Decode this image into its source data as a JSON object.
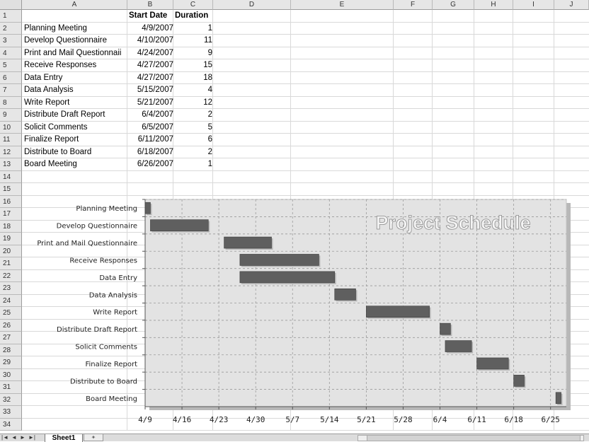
{
  "spreadsheet": {
    "columns": [
      "A",
      "B",
      "C",
      "D",
      "E",
      "F",
      "G",
      "H",
      "I",
      "J"
    ],
    "row_numbers": [
      "1",
      "2",
      "3",
      "4",
      "5",
      "6",
      "7",
      "8",
      "9",
      "10",
      "11",
      "12",
      "13",
      "14",
      "15",
      "16",
      "17",
      "18",
      "19",
      "20",
      "21",
      "22",
      "23",
      "24",
      "25",
      "26",
      "27",
      "28",
      "29",
      "30",
      "31",
      "32",
      "33",
      "34"
    ],
    "header": {
      "start_date": "Start Date",
      "duration": "Duration"
    },
    "tasks": [
      {
        "name": "Planning Meeting",
        "start": "4/9/2007",
        "duration": "1"
      },
      {
        "name": "Develop Questionnaire",
        "start": "4/10/2007",
        "duration": "11"
      },
      {
        "name": "Print and Mail Questionnaii",
        "start": "4/24/2007",
        "duration": "9"
      },
      {
        "name": "Receive Responses",
        "start": "4/27/2007",
        "duration": "15"
      },
      {
        "name": "Data Entry",
        "start": "4/27/2007",
        "duration": "18"
      },
      {
        "name": "Data Analysis",
        "start": "5/15/2007",
        "duration": "4"
      },
      {
        "name": "Write Report",
        "start": "5/21/2007",
        "duration": "12"
      },
      {
        "name": "Distribute Draft Report",
        "start": "6/4/2007",
        "duration": "2"
      },
      {
        "name": "Solicit Comments",
        "start": "6/5/2007",
        "duration": "5"
      },
      {
        "name": "Finalize Report",
        "start": "6/11/2007",
        "duration": "6"
      },
      {
        "name": "Distribute to Board",
        "start": "6/18/2007",
        "duration": "2"
      },
      {
        "name": "Board Meeting",
        "start": "6/26/2007",
        "duration": "1"
      }
    ]
  },
  "sheet_tabs": {
    "active": "Sheet1",
    "nav": [
      "|◄",
      "◄",
      "►",
      "►|"
    ]
  },
  "chart_data": {
    "type": "bar",
    "orientation": "horizontal-gantt",
    "title": "Project Schedule",
    "categories": [
      "Planning Meeting",
      "Develop Questionnaire",
      "Print and Mail Questionnaire",
      "Receive Responses",
      "Data Entry",
      "Data Analysis",
      "Write Report",
      "Distribute Draft Report",
      "Solicit Comments",
      "Finalize Report",
      "Distribute to Board",
      "Board Meeting"
    ],
    "start": [
      "2007-04-09",
      "2007-04-10",
      "2007-04-24",
      "2007-04-27",
      "2007-04-27",
      "2007-05-15",
      "2007-05-21",
      "2007-06-04",
      "2007-06-05",
      "2007-06-11",
      "2007-06-18",
      "2007-06-26"
    ],
    "duration_days": [
      1,
      11,
      9,
      15,
      18,
      4,
      12,
      2,
      5,
      6,
      2,
      1
    ],
    "x_ticks": [
      "4/9",
      "4/16",
      "4/23",
      "4/30",
      "5/7",
      "5/14",
      "5/21",
      "5/28",
      "6/4",
      "6/11",
      "6/18",
      "6/25"
    ],
    "xlim": [
      "2007-04-09",
      "2007-06-28"
    ],
    "grid": true,
    "bar_color": "#5f5f5f",
    "plot_bg": "#e3e3e3"
  }
}
